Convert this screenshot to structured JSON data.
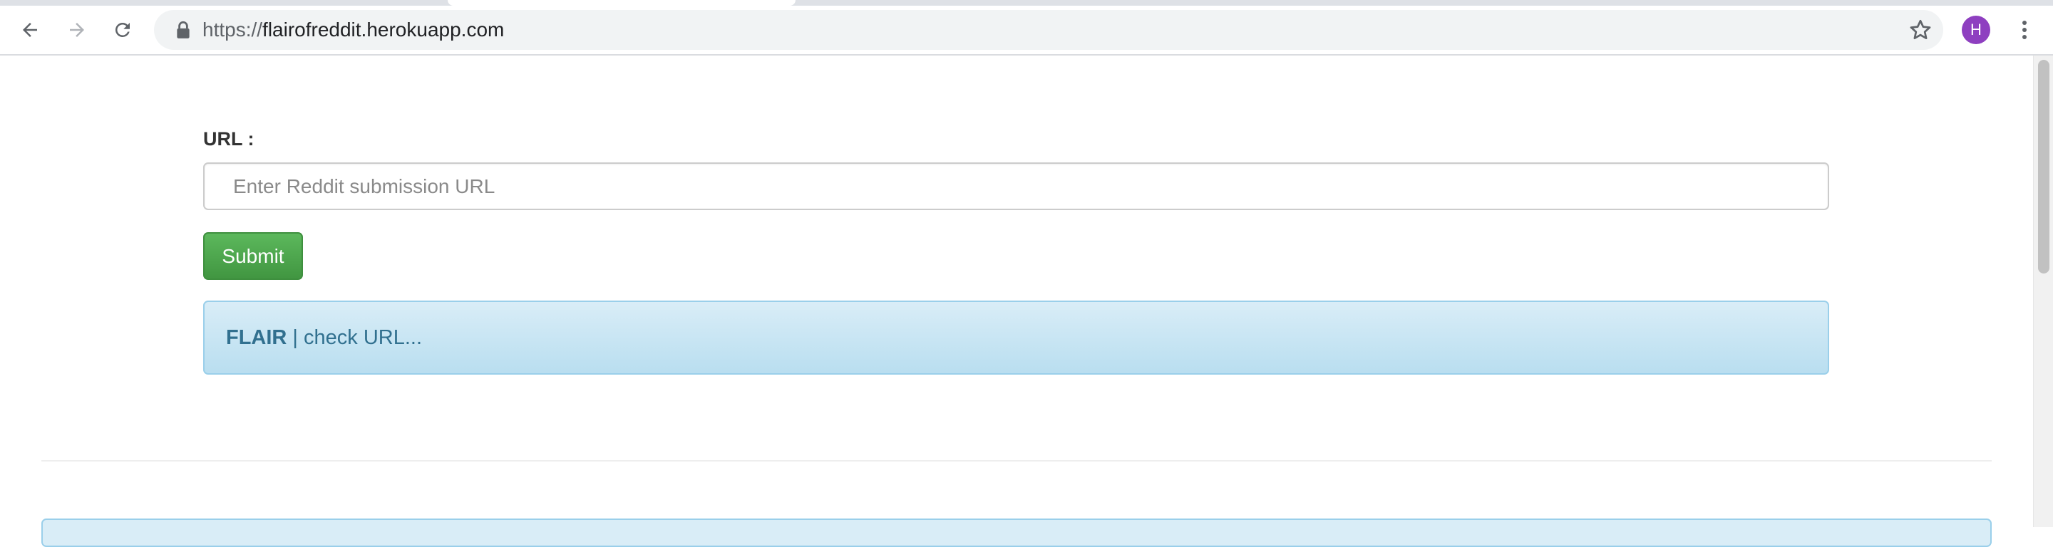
{
  "browser": {
    "url_scheme": "https://",
    "url_host": "flairofreddit.herokuapp.com",
    "avatar_letter": "H",
    "icons": [
      "back-arrow-icon",
      "forward-arrow-icon",
      "reload-icon",
      "lock-icon",
      "star-icon",
      "kebab-menu-icon"
    ]
  },
  "form": {
    "url_label": "URL :",
    "url_placeholder": "Enter Reddit submission URL",
    "url_value": "",
    "submit_label": "Submit"
  },
  "result": {
    "flair_key": "FLAIR",
    "separator": " | ",
    "message": "check URL..."
  },
  "colors": {
    "submit_green": "#5cb85c",
    "info_blue": "#d9edf7",
    "info_text": "#31708f",
    "avatar_purple": "#8e3fc0"
  }
}
